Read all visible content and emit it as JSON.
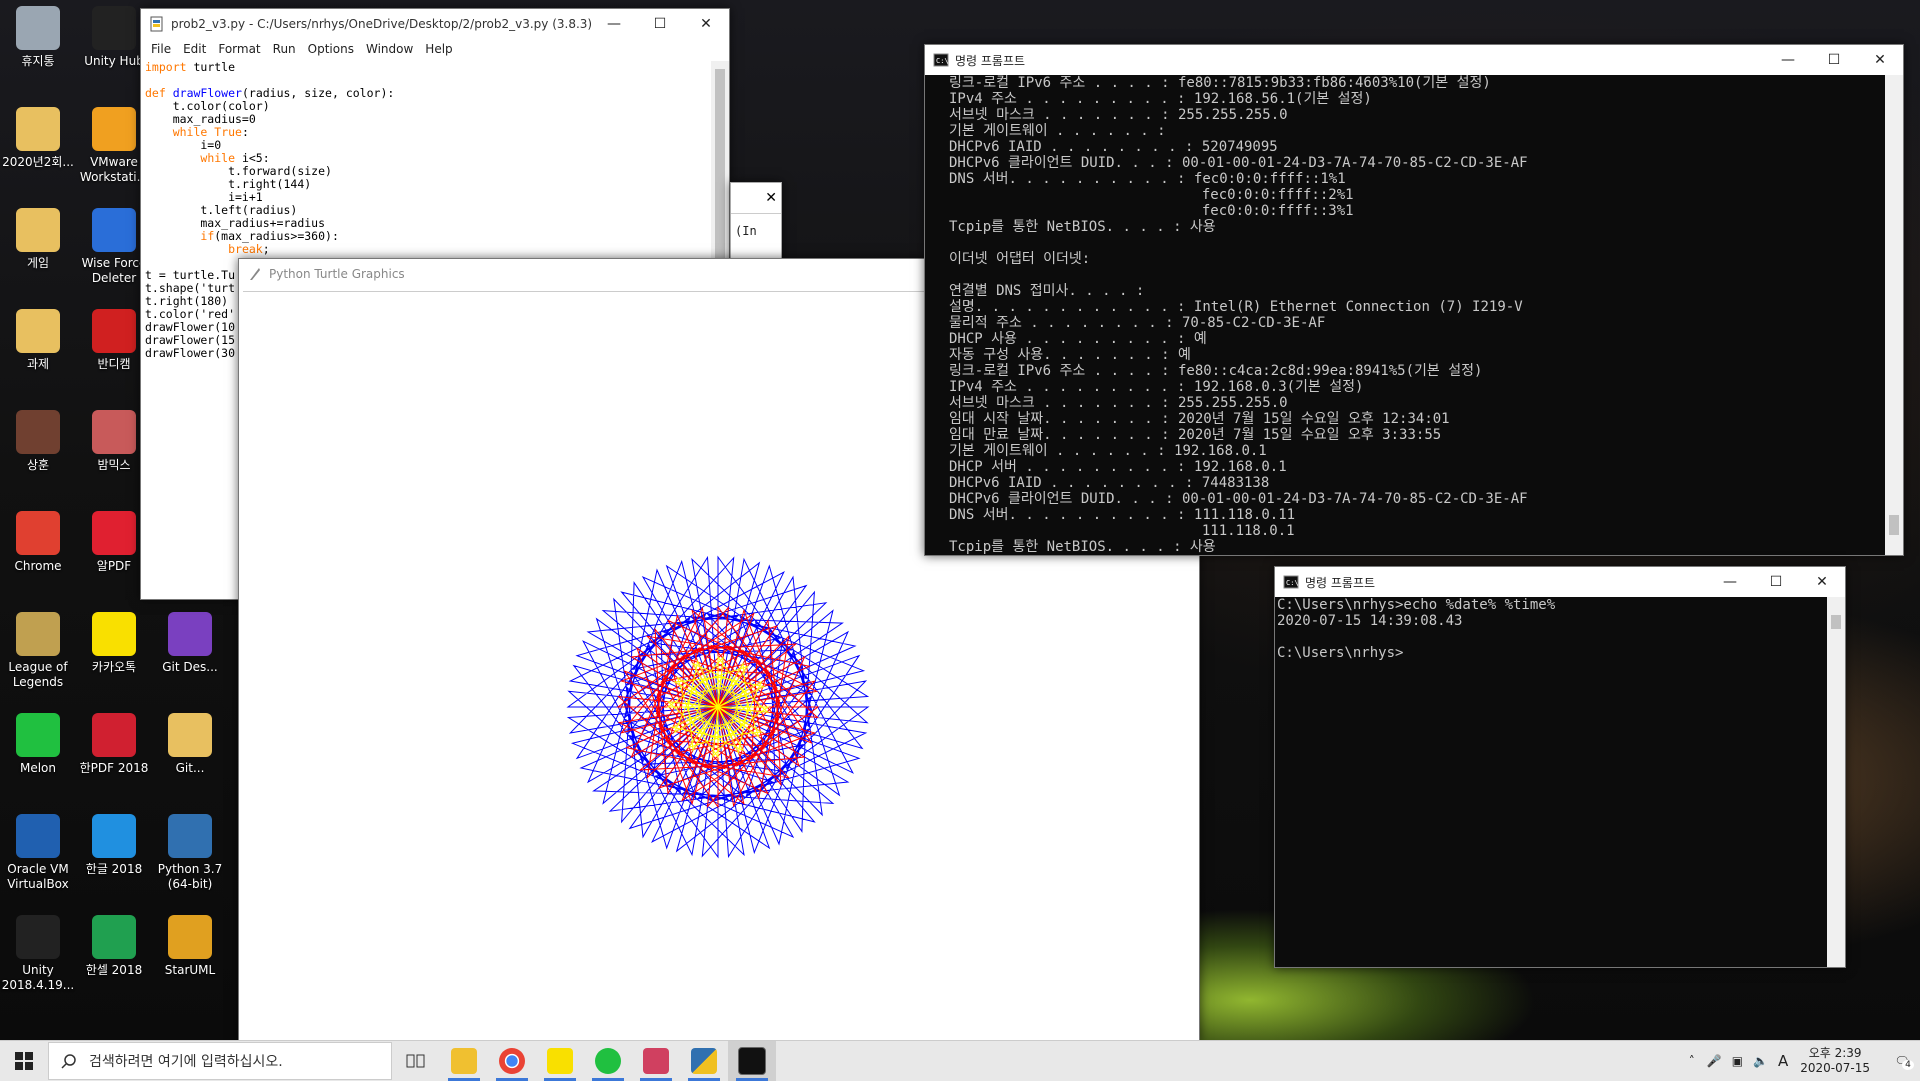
{
  "desktop": {
    "icons": [
      {
        "label": "휴지통",
        "color": "#9aa6b2"
      },
      {
        "label": "Unity Hub",
        "color": "#222222"
      },
      {
        "label": "2020년2회...",
        "color": "#e8c060"
      },
      {
        "label": "VMware Workstati...",
        "color": "#f0a020"
      },
      {
        "label": "게임",
        "color": "#e8c060"
      },
      {
        "label": "Wise Force Deleter",
        "color": "#2a6ed8"
      },
      {
        "label": "과제",
        "color": "#e8c060"
      },
      {
        "label": "반디캠",
        "color": "#d02020"
      },
      {
        "label": "상훈",
        "color": "#704030"
      },
      {
        "label": "밤믹스",
        "color": "#c85a5a"
      },
      {
        "label": "Chrome",
        "color": "#e04030"
      },
      {
        "label": "알PDF",
        "color": "#e02030"
      },
      {
        "label": "League of Legends",
        "color": "#c0a050"
      },
      {
        "label": "카카오톡",
        "color": "#f9e000"
      },
      {
        "label": "Git Des...",
        "color": "#7a40c0"
      },
      {
        "label": "Melon",
        "color": "#20c040"
      },
      {
        "label": "한PDF 2018",
        "color": "#d02030"
      },
      {
        "label": "Git...",
        "color": "#e8c060"
      },
      {
        "label": "Oracle VM VirtualBox",
        "color": "#2060b0"
      },
      {
        "label": "한글 2018",
        "color": "#2090e0"
      },
      {
        "label": "Python 3.7 (64-bit)",
        "color": "#3070b0"
      },
      {
        "label": "Unity 2018.4.19...",
        "color": "#222222"
      },
      {
        "label": "한셀 2018",
        "color": "#20a050"
      },
      {
        "label": "StarUML",
        "color": "#e0a020"
      }
    ]
  },
  "idle": {
    "title": "prob2_v3.py - C:/Users/nrhys/OneDrive/Desktop/2/prob2_v3.py (3.8.3)",
    "menu": [
      "File",
      "Edit",
      "Format",
      "Run",
      "Options",
      "Window",
      "Help"
    ],
    "code_lines": [
      "import turtle",
      "",
      "def drawFlower(radius, size, color):",
      "    t.color(color)",
      "    max_radius=0",
      "    while True:",
      "        i=0",
      "        while i<5:",
      "            t.forward(size)",
      "            t.right(144)",
      "            i=i+1",
      "        t.left(radius)",
      "        max_radius+=radius",
      "        if(max_radius>=360):",
      "            break;",
      "",
      "t = turtle.Tu",
      "t.shape('turt",
      "t.right(180)",
      "t.color('red'",
      "drawFlower(10",
      "drawFlower(15",
      "drawFlower(30"
    ]
  },
  "shell": {
    "fragment": "(In"
  },
  "turtle": {
    "title": "Python Turtle Graphics",
    "flowers": [
      {
        "radius": 10,
        "size": 300,
        "color": "#0000ff"
      },
      {
        "radius": 15,
        "size": 200,
        "color": "#ff0000"
      },
      {
        "radius": 30,
        "size": 100,
        "color": "#ffff00"
      }
    ]
  },
  "cmd1": {
    "title": "명령 프롬프트",
    "lines": [
      "링크-로컬 IPv6 주소 . . . . : fe80::7815:9b33:fb86:4603%10(기본 설정)",
      "IPv4 주소 . . . . . . . . . : 192.168.56.1(기본 설정)",
      "서브넷 마스크 . . . . . . . : 255.255.255.0",
      "기본 게이트웨이 . . . . . . :",
      "DHCPv6 IAID . . . . . . . . : 520749095",
      "DHCPv6 클라이언트 DUID. . . : 00-01-00-01-24-D3-7A-74-70-85-C2-CD-3E-AF",
      "DNS 서버. . . . . . . . . . : fec0:0:0:ffff::1%1",
      "                              fec0:0:0:ffff::2%1",
      "                              fec0:0:0:ffff::3%1",
      "Tcpip를 통한 NetBIOS. . . . : 사용",
      "",
      "이더넷 어댑터 이더넷:",
      "",
      "연결별 DNS 접미사. . . . :",
      "설명. . . . . . . . . . . . : Intel(R) Ethernet Connection (7) I219-V",
      "물리적 주소 . . . . . . . . : 70-85-C2-CD-3E-AF",
      "DHCP 사용 . . . . . . . . . : 예",
      "자동 구성 사용. . . . . . . : 예",
      "링크-로컬 IPv6 주소 . . . . : fe80::c4ca:2c8d:99ea:8941%5(기본 설정)",
      "IPv4 주소 . . . . . . . . . : 192.168.0.3(기본 설정)",
      "서브넷 마스크 . . . . . . . : 255.255.255.0",
      "임대 시작 날짜. . . . . . . : 2020년 7월 15일 수요일 오후 12:34:01",
      "임대 만료 날짜. . . . . . . : 2020년 7월 15일 수요일 오후 3:33:55",
      "기본 게이트웨이 . . . . . . : 192.168.0.1",
      "DHCP 서버 . . . . . . . . . : 192.168.0.1",
      "DHCPv6 IAID . . . . . . . . : 74483138",
      "DHCPv6 클라이언트 DUID. . . : 00-01-00-01-24-D3-7A-74-70-85-C2-CD-3E-AF",
      "DNS 서버. . . . . . . . . . : 111.118.0.11",
      "                              111.118.0.1",
      "Tcpip를 통한 NetBIOS. . . . : 사용"
    ]
  },
  "cmd2": {
    "title": "명령 프롬프트",
    "lines": [
      "C:\\Users\\nrhys>echo %date% %time%",
      "2020-07-15 14:39:08.43",
      "",
      "C:\\Users\\nrhys>"
    ]
  },
  "taskbar": {
    "search_placeholder": "검색하려면 여기에 입력하십시오.",
    "apps": [
      "task-view",
      "file-explorer",
      "chrome",
      "kakaotalk",
      "melon",
      "snipping",
      "python",
      "cmd"
    ],
    "tray_time": "오후 2:39",
    "tray_date": "2020-07-15",
    "ime": "A",
    "notification_count": "4"
  }
}
